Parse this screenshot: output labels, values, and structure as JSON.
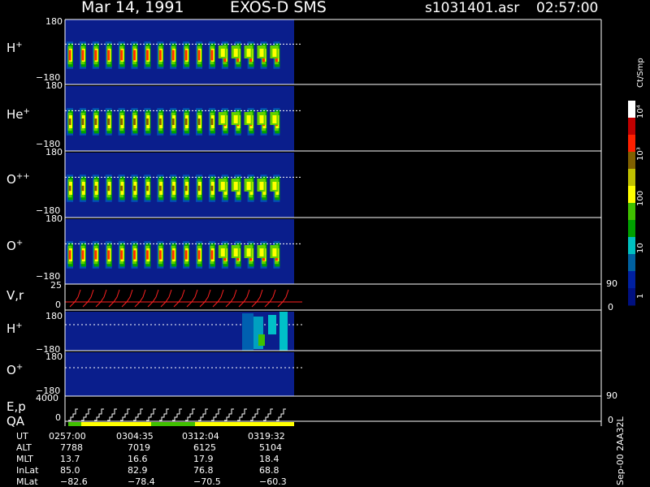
{
  "header": {
    "date": "Mar 14, 1991",
    "instrument": "EXOS-D SMS",
    "file": "s1031401.asr",
    "time": "02:57:00"
  },
  "colorbar": {
    "unit_label": "Ct/Smp",
    "labels": [
      "10⁴",
      "10³",
      "100",
      "10",
      "1"
    ],
    "colors": [
      "#ffffff",
      "#c00000",
      "#ff2000",
      "#806000",
      "#c0c000",
      "#ffff00",
      "#40c000",
      "#00a000",
      "#00c0c0",
      "#0060a0",
      "#0020a0",
      "#001080"
    ]
  },
  "panels": [
    {
      "label_main": "H",
      "label_sup": "+",
      "ymax": "180",
      "ymin": "−180"
    },
    {
      "label_main": "He",
      "label_sup": "+",
      "ymax": "180",
      "ymin": "−180"
    },
    {
      "label_main": "O",
      "label_sup": "++",
      "ymax": "180",
      "ymin": "−180"
    },
    {
      "label_main": "O",
      "label_sup": "+",
      "ymax": "180",
      "ymin": "−180"
    }
  ],
  "vr_panel": {
    "label": "V,r",
    "ymax": "25",
    "ymin": "0",
    "right_max": "90",
    "right_min": "0"
  },
  "lower_panels": [
    {
      "label_main": "H",
      "label_sup": "+",
      "ymax": "180",
      "ymin": "−180"
    },
    {
      "label_main": "O",
      "label_sup": "+",
      "ymax": "180",
      "ymin": "−180"
    }
  ],
  "ep_panel": {
    "label_top": "E,p",
    "label_bottom": "QA",
    "ymax": "4000",
    "ymin": "0",
    "right_max": "90",
    "right_min": "0"
  },
  "footer": {
    "row_labels": [
      "UT",
      "ALT",
      "MLT",
      "InLat",
      "MLat"
    ],
    "columns": [
      [
        "0257:00",
        "7788",
        "13.7",
        "85.0",
        "−82.6"
      ],
      [
        "0304:35",
        "7019",
        "16.6",
        "82.9",
        "−78.4"
      ],
      [
        "0312:04",
        "6125",
        "17.9",
        "76.8",
        "−70.5"
      ],
      [
        "0319:32",
        "5104",
        "18.4",
        "68.8",
        "−60.3"
      ]
    ],
    "side_note": "Sep-00 2AA32L"
  },
  "chart_data": {
    "type": "heatmap",
    "title": "Mar 14, 1991   EXOS-D SMS",
    "x": [
      "0257:00",
      "0304:35",
      "0312:04",
      "0319:32"
    ],
    "panels": [
      "H+",
      "He+",
      "O++",
      "O+",
      "V,r",
      "H+",
      "O+",
      "E,p"
    ],
    "ylim": [
      -180,
      180
    ],
    "colorscale": {
      "label": "Ct/Smp",
      "range": [
        1,
        10000
      ],
      "log": true
    }
  }
}
